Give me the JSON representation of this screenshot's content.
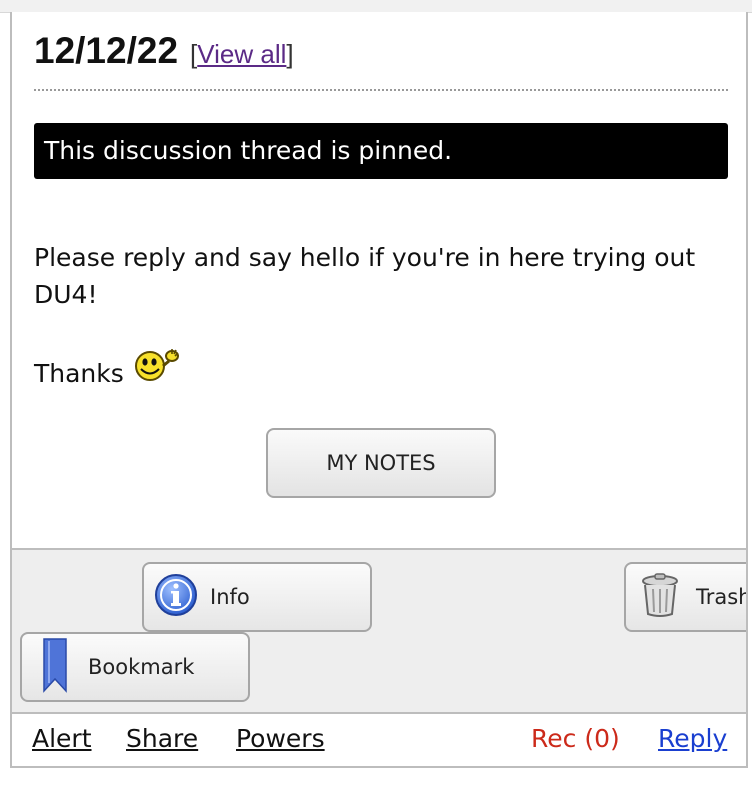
{
  "header": {
    "date": "12/12/22",
    "view_all_open": "[",
    "view_all_label": "View all",
    "view_all_close": "]"
  },
  "thread": {
    "pinned_notice": "This discussion thread is pinned.",
    "message": "Please reply and say hello if you're in here trying out DU4!",
    "thanks": "Thanks",
    "smiley_icon": "smiley-wave-icon"
  },
  "buttons": {
    "my_notes": "MY NOTES"
  },
  "toolbar": {
    "info": {
      "label": "Info",
      "icon": "info-icon"
    },
    "trash": {
      "label": "Trash",
      "icon": "trash-icon"
    },
    "bookmark": {
      "label": "Bookmark",
      "icon": "bookmark-icon"
    }
  },
  "footer": {
    "alert": "Alert",
    "share": "Share",
    "powers": "Powers",
    "rec": "Rec (0)",
    "reply": "Reply"
  },
  "colors": {
    "link_visited": "#5b2a86",
    "rec": "#cc2a1a",
    "reply_link": "#1a3fd0",
    "pinned_bg": "#000000"
  }
}
